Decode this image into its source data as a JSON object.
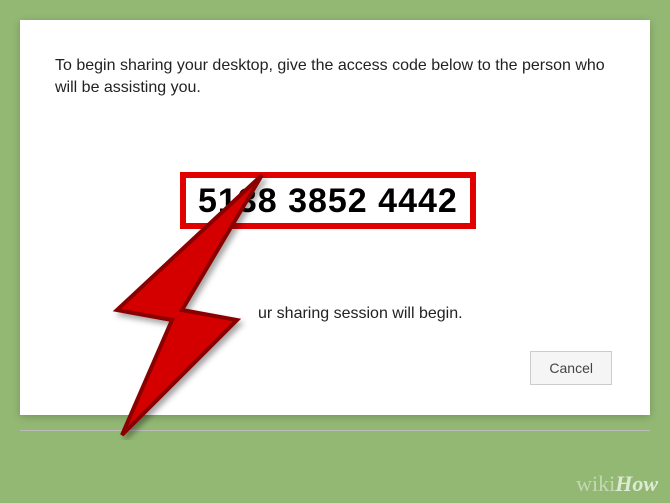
{
  "instruction": "To begin sharing your desktop, give the access code below to the person who will be assisting you.",
  "access_code": "5138 3852 4442",
  "session_text_fragment": "ur sharing session will begin.",
  "cancel_label": "Cancel",
  "watermark": {
    "wiki": "wiki",
    "how": "How"
  },
  "colors": {
    "highlight": "#e00000",
    "background": "#93b874"
  }
}
